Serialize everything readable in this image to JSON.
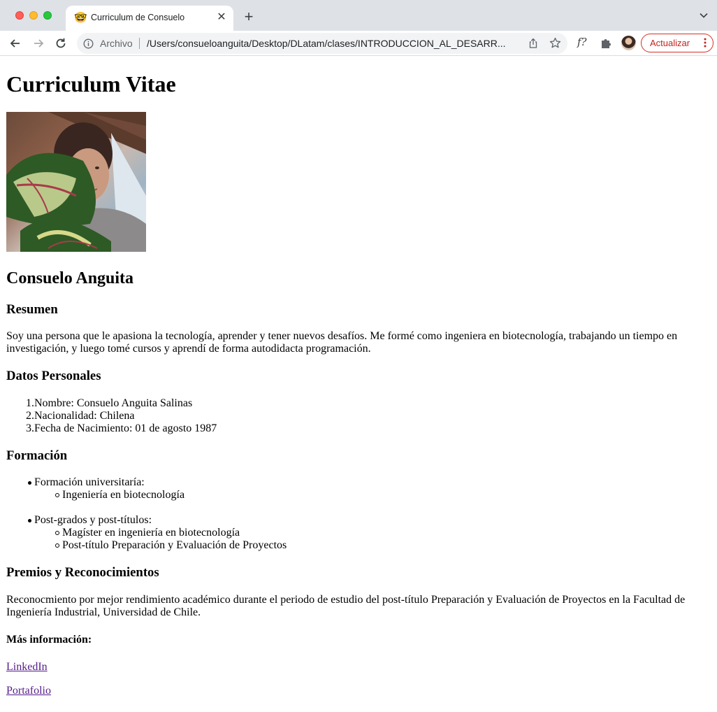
{
  "browser": {
    "tab_title": "Curriculum de Consuelo",
    "tab_favicon": "🤓",
    "scheme_label": "Archivo",
    "url": "/Users/consueloanguita/Desktop/DLatam/clases/INTRODUCCION_AL_DESARR...",
    "extension_label": "f?",
    "update_label": "Actualizar",
    "colors": {
      "tabstrip": "#dee1e6",
      "update_accent": "#d93025"
    }
  },
  "page": {
    "title": "Curriculum Vitae",
    "name": "Consuelo Anguita",
    "resumen": {
      "heading": "Resumen",
      "lines": [
        "Soy una persona que le apasiona la tecnología, aprender y tener nuevos desafíos. Me formé como ingeniera en biotecnología, trabajando un tiempo en",
        "investigación, y luego tomé cursos y aprendí de forma autodidacta programación."
      ]
    },
    "datos": {
      "heading": "Datos Personales",
      "items": [
        "Nombre: Consuelo Anguita Salinas",
        "Nacionalidad: Chilena",
        "Fecha de Nacimiento: 01 de agosto 1987"
      ]
    },
    "formacion": {
      "heading": "Formación",
      "groups": [
        {
          "label": "Formación universitaría:",
          "items": [
            "Ingeniería en biotecnología"
          ]
        },
        {
          "label": "Post-grados y post-títulos:",
          "items": [
            "Magíster en ingeniería en biotecnología",
            "Post-título Preparación y Evaluación de Proyectos"
          ]
        }
      ]
    },
    "premios": {
      "heading": "Premios y Reconocimientos",
      "lines": [
        "Reconocmiento por mejor rendimiento académico durante el periodo de estudio del post-título Preparación y Evaluación de Proyectos en la Facultad de",
        "Ingeniería Industrial, Universidad de Chile."
      ]
    },
    "mas_info": {
      "heading": "Más información:",
      "links": [
        "LinkedIn",
        "Portafolio"
      ]
    }
  }
}
